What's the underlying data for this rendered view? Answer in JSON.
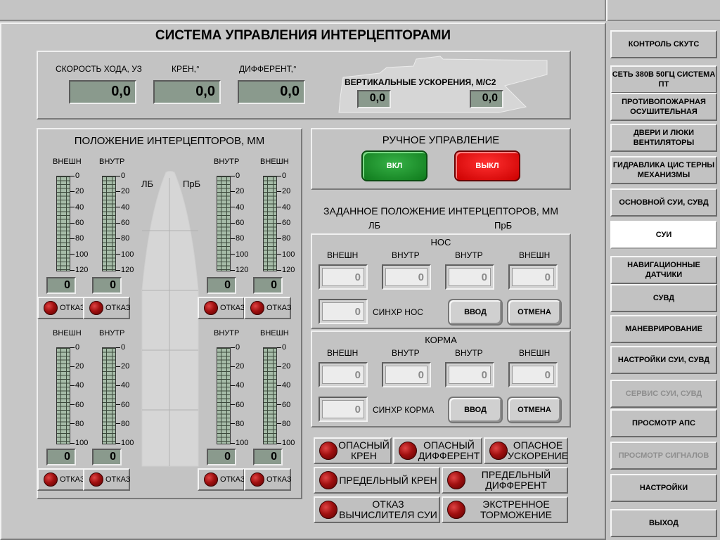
{
  "header": {
    "title": "СИСТЕМА УПРАВЛЕНИЯ ИНТЕРЦЕПТОРАМИ"
  },
  "status": {
    "speed_label": "СКОРОСТЬ ХОДА, УЗ",
    "speed": "0,0",
    "roll_label": "КРЕН,°",
    "roll": "0,0",
    "trim_label": "ДИФФЕРЕНТ,°",
    "trim": "0,0",
    "accel_label": "ВЕРТИКАЛЬНЫЕ УСКОРЕНИЯ, М/с2",
    "accel_fore": "0,0",
    "accel_aft": "0,0"
  },
  "position": {
    "title": "ПОЛОЖЕНИЕ ИНТЕРЦЕПТОРОВ, ММ",
    "lb": "ЛБ",
    "prb": "ПрБ",
    "outer": "ВНЕШН",
    "inner": "ВНУТР",
    "top_ticks": [
      "0",
      "20",
      "40",
      "60",
      "80",
      "100",
      "120"
    ],
    "bottom_ticks": [
      "0",
      "20",
      "40",
      "60",
      "80",
      "100"
    ],
    "fail": "ОТКАЗ",
    "values": {
      "top_lb_outer": "0",
      "top_lb_inner": "0",
      "top_pb_inner": "0",
      "top_pb_outer": "0",
      "bot_lb_outer": "0",
      "bot_lb_inner": "0",
      "bot_pb_inner": "0",
      "bot_pb_outer": "0"
    }
  },
  "manual": {
    "title": "РУЧНОЕ УПРАВЛЕНИЕ",
    "on": "ВКЛ",
    "off": "ВЫКЛ"
  },
  "setpoint": {
    "title": "ЗАДАННОЕ ПОЛОЖЕНИЕ ИНТЕРЦЕПТОРОВ, ММ",
    "lb": "ЛБ",
    "prb": "ПрБ",
    "outer": "ВНЕШН",
    "inner": "ВНУТР",
    "enter": "ВВОД",
    "cancel": "ОТМЕНА",
    "bow": {
      "title": "НОС",
      "sync_label": "СИНХР НОС",
      "outer_l": "0",
      "inner_l": "0",
      "inner_r": "0",
      "outer_r": "0",
      "sync": "0"
    },
    "stern": {
      "title": "КОРМА",
      "sync_label": "СИНХР КОРМА",
      "outer_l": "0",
      "inner_l": "0",
      "inner_r": "0",
      "outer_r": "0",
      "sync": "0"
    }
  },
  "alarms": {
    "danger_roll": "ОПАСНЫЙ КРЕН",
    "danger_trim": "ОПАСНЫЙ ДИФФЕРЕНТ",
    "danger_accel": "ОПАСНОЕ УСКОРЕНИЕ",
    "limit_roll": "ПРЕДЕЛЬНЫЙ КРЕН",
    "limit_trim": "ПРЕДЕЛЬНЫЙ ДИФФЕРЕНТ",
    "computer_fail": "ОТКАЗ ВЫЧИСЛИТЕЛЯ СУИ",
    "emergency_brake": "ЭКСТРЕННОЕ ТОРМОЖЕНИЕ"
  },
  "nav": [
    {
      "label": "КОНТРОЛЬ СКУТС",
      "state": "normal"
    },
    {
      "label": "СЕТЬ 380В 50ГЦ СИСТЕМА ПТ",
      "state": "normal"
    },
    {
      "label": "ПРОТИВОПОЖАРНАЯ ОСУШИТЕЛЬНАЯ",
      "state": "normal"
    },
    {
      "label": "ДВЕРИ И ЛЮКИ ВЕНТИЛЯТОРЫ",
      "state": "normal"
    },
    {
      "label": "ГИДРАВЛИКА ЦИС ТЕРНЫ МЕХАНИЗМЫ",
      "state": "normal"
    },
    {
      "label": "ОСНОВНОЙ СУИ, СУВД",
      "state": "normal"
    },
    {
      "label": "СУИ",
      "state": "active"
    },
    {
      "label": "НАВИГАЦИОННЫЕ ДАТЧИКИ",
      "state": "normal"
    },
    {
      "label": "СУВД",
      "state": "normal"
    },
    {
      "label": "МАНЕВРИРОВАНИЕ",
      "state": "normal"
    },
    {
      "label": "НАСТРОЙКИ СУИ, СУВД",
      "state": "normal"
    },
    {
      "label": "СЕРВИС СУИ, СУВД",
      "state": "disabled"
    },
    {
      "label": "ПРОСМОТР АПС",
      "state": "normal"
    },
    {
      "label": "ПРОСМОТР СИГНАЛОВ",
      "state": "disabled"
    },
    {
      "label": "НАСТРОЙКИ",
      "state": "normal"
    },
    {
      "label": "ВЫХОД",
      "state": "normal"
    }
  ]
}
